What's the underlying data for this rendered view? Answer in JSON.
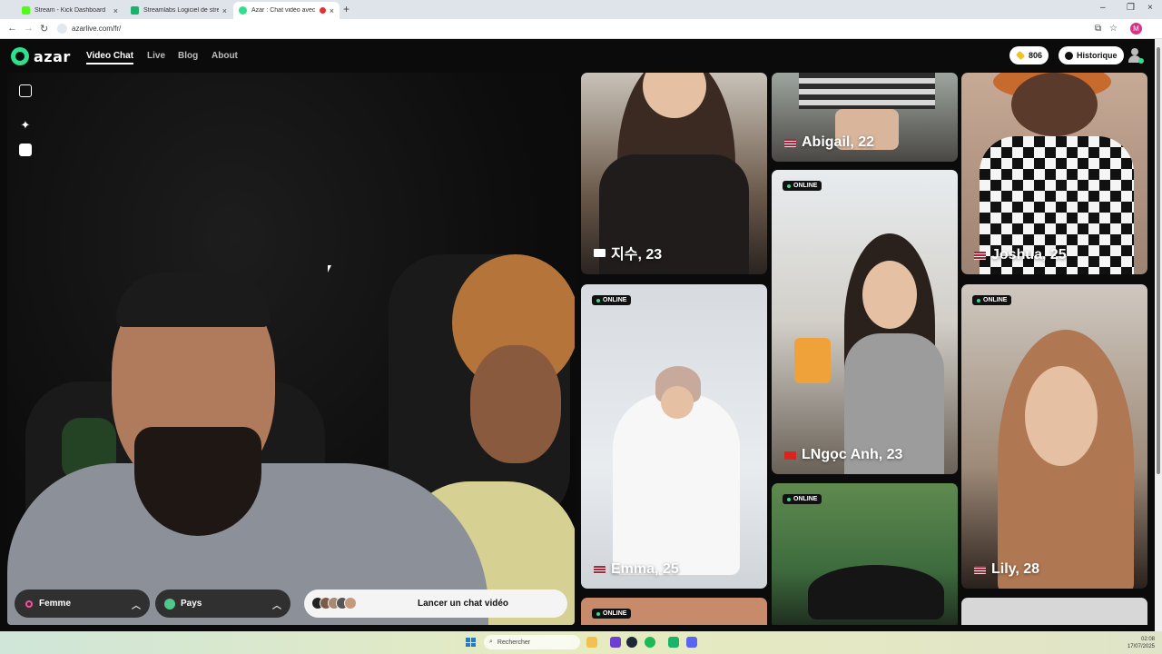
{
  "browser": {
    "tabs": [
      {
        "title": "Stream - Kick Dashboard",
        "favicon_color": "#53fc18"
      },
      {
        "title": "Streamlabs Logiciel de streami",
        "favicon_color": "#1bb36b"
      },
      {
        "title": "Azar : Chat vidéo avec de n",
        "favicon_color": "#2ee08c"
      }
    ],
    "new_tab": "+",
    "url": "azarlive.com/fr/",
    "profile_initial": "M"
  },
  "site": {
    "logo_text": "azar",
    "nav": [
      "Video Chat",
      "Live",
      "Blog",
      "About"
    ],
    "coins": "806",
    "history_label": "Historique"
  },
  "controls": {
    "gender": "Femme",
    "country": "Pays",
    "start_label": "Lancer un chat vidéo"
  },
  "profiles": [
    {
      "name": "지수, 23",
      "flag": "kr"
    },
    {
      "name": "Abigail, 22",
      "flag": "us"
    },
    {
      "name": "Joshua, 25",
      "flag": "us"
    },
    {
      "name": "LNgọc Anh, 23",
      "flag": "vn",
      "online": "ONLINE"
    },
    {
      "name": "Emma, 25",
      "flag": "us",
      "online": "ONLINE"
    },
    {
      "name": "Lily, 28",
      "flag": "us",
      "online": "ONLINE"
    },
    {
      "online": "ONLINE"
    },
    {
      "online": "ONLINE"
    }
  ],
  "taskbar": {
    "search_placeholder": "Rechercher",
    "time": "02:08",
    "date": "17/07/2025"
  }
}
